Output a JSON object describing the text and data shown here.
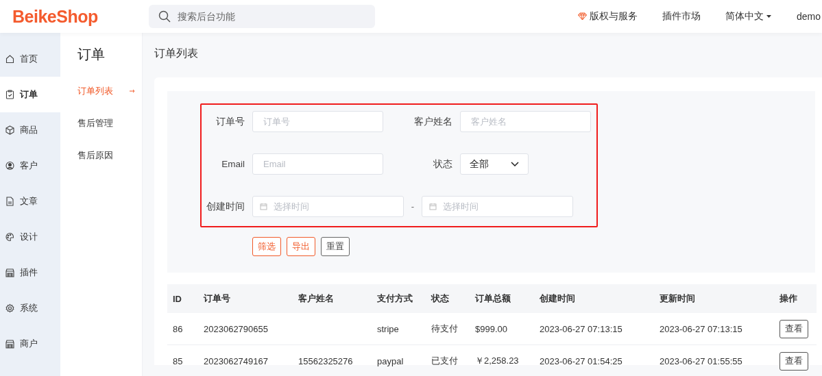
{
  "header": {
    "logo": "BeikeShop",
    "search": {
      "placeholder": "搜索后台功能"
    },
    "links": [
      "版权与服务",
      "插件市场"
    ],
    "language": "简体中文",
    "user": "demo"
  },
  "nav": [
    {
      "label": "首页",
      "selected": false
    },
    {
      "label": "订单",
      "selected": true
    },
    {
      "label": "商品",
      "selected": false
    },
    {
      "label": "客户",
      "selected": false
    },
    {
      "label": "文章",
      "selected": false
    },
    {
      "label": "设计",
      "selected": false
    },
    {
      "label": "插件",
      "selected": false
    },
    {
      "label": "系统",
      "selected": false
    },
    {
      "label": "商户",
      "selected": false
    }
  ],
  "submenu": {
    "title": "订单",
    "items": [
      {
        "label": "订单列表",
        "selected": true
      },
      {
        "label": "售后管理",
        "selected": false
      },
      {
        "label": "售后原因",
        "selected": false
      }
    ]
  },
  "page_title": "订单列表",
  "filters": {
    "order_no": {
      "label": "订单号",
      "placeholder": "订单号"
    },
    "customer": {
      "label": "客户姓名",
      "placeholder": "客户姓名"
    },
    "email": {
      "label": "Email",
      "placeholder": "Email"
    },
    "status": {
      "label": "状态",
      "value": "全部"
    },
    "created": {
      "label": "创建时间",
      "from_placeholder": "选择时间",
      "separator": "-",
      "to_placeholder": "选择时间"
    },
    "buttons": [
      {
        "label": "筛选",
        "kind": "primary"
      },
      {
        "label": "导出",
        "kind": "primary"
      },
      {
        "label": "重置",
        "kind": "secondary"
      }
    ]
  },
  "table": {
    "columns": [
      "ID",
      "订单号",
      "客户姓名",
      "支付方式",
      "状态",
      "订单总额",
      "创建时间",
      "更新时间",
      "操作"
    ],
    "rows": [
      {
        "cells": [
          "86",
          "2023062790655",
          "",
          "stripe",
          "待支付",
          "$999.00",
          "2023-06-27 07:13:15",
          "2023-06-27 07:13:15"
        ],
        "action": "查看"
      },
      {
        "cells": [
          "85",
          "2023062749167",
          "15562325276",
          "paypal",
          "已支付",
          "￥2,258.23",
          "2023-06-27 01:54:25",
          "2023-06-27 01:55:55"
        ],
        "action": "查看"
      }
    ]
  }
}
